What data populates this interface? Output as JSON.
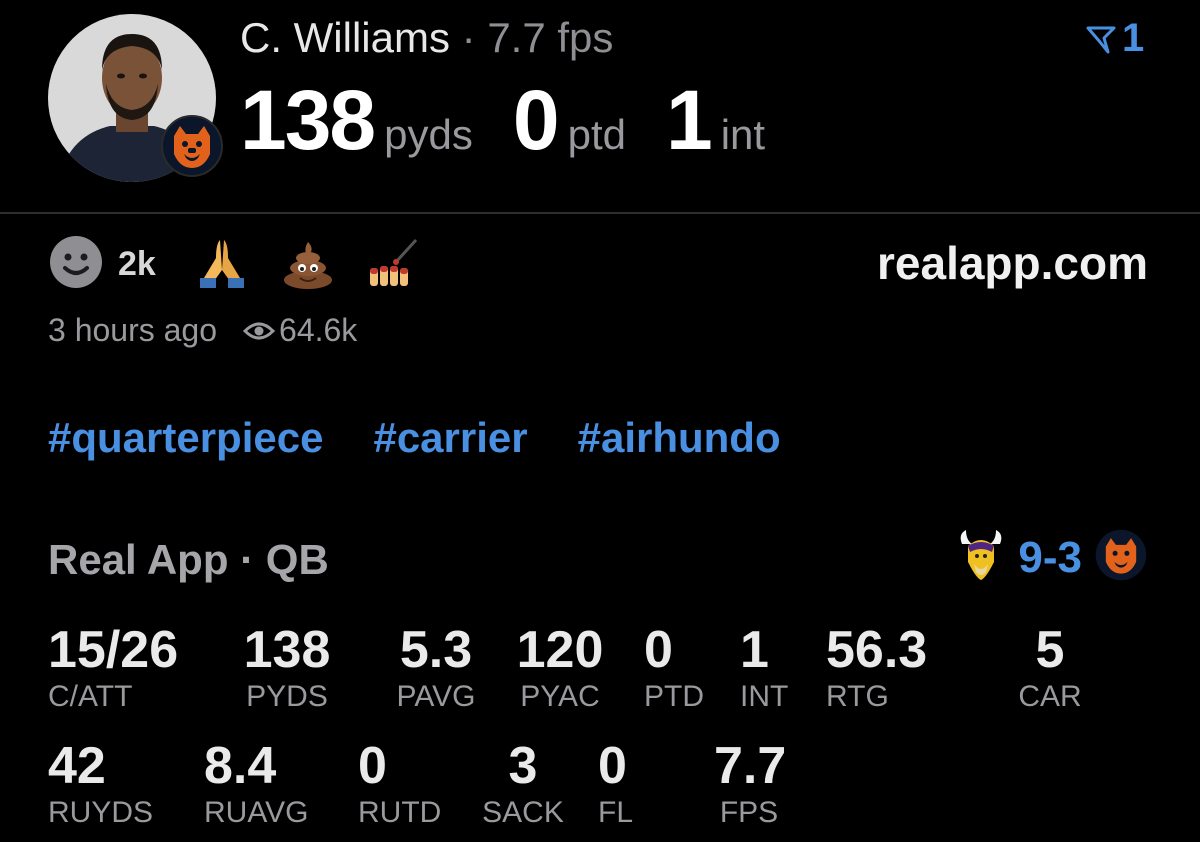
{
  "header": {
    "player_name": "C. Williams",
    "separator": "·",
    "fps_text": "7.7 fps",
    "stats": [
      {
        "value": "138",
        "unit": "pyds"
      },
      {
        "value": "0",
        "unit": "ptd"
      },
      {
        "value": "1",
        "unit": "int"
      }
    ],
    "rank": "1"
  },
  "reactions": {
    "count": "2k",
    "emojis": [
      "smiley-icon",
      "praying-hands-icon",
      "poop-icon",
      "nail-polish-icon"
    ]
  },
  "site": "realapp.com",
  "meta": {
    "time": "3 hours ago",
    "views": "64.6k"
  },
  "tags": [
    "#quarterpiece",
    "#carrier",
    "#airhundo"
  ],
  "section": {
    "title": "Real App · QB",
    "score": "9-3"
  },
  "stats_row1": [
    {
      "value": "15/26",
      "label": "C/ATT"
    },
    {
      "value": "138",
      "label": "PYDS"
    },
    {
      "value": "5.3",
      "label": "PAVG"
    },
    {
      "value": "120",
      "label": "PYAC"
    },
    {
      "value": "0",
      "label": "PTD"
    },
    {
      "value": "1",
      "label": "INT"
    },
    {
      "value": "56.3",
      "label": "RTG"
    },
    {
      "value": "5",
      "label": "CAR"
    }
  ],
  "stats_row2": [
    {
      "value": "42",
      "label": "RUYDS"
    },
    {
      "value": "8.4",
      "label": "RUAVG"
    },
    {
      "value": "0",
      "label": "RUTD"
    },
    {
      "value": "3",
      "label": "SACK"
    },
    {
      "value": "0",
      "label": "FL"
    },
    {
      "value": "7.7",
      "label": "FPS"
    }
  ],
  "colors": {
    "accent_blue": "#4a90e2",
    "background": "#000000",
    "muted_text": "#9a9a9e",
    "bears_orange": "#e2621b",
    "bears_navy": "#0b162a"
  }
}
